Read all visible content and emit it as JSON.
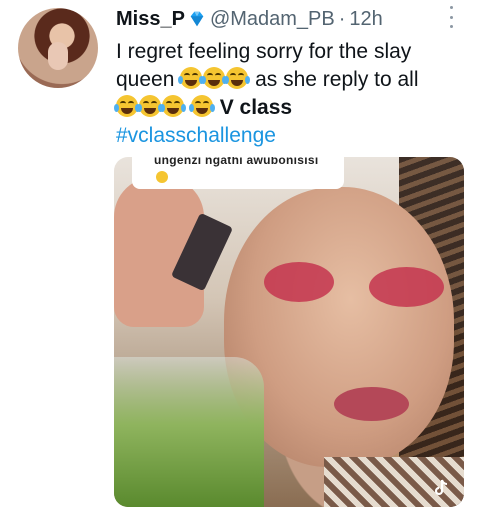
{
  "author": {
    "name": "Miss_P",
    "handle": "@Madam_PB",
    "separator": "·",
    "time": "12h",
    "badge_icon": "blue-diamond-icon"
  },
  "tweet": {
    "line1": "I regret feeling sorry for the slay",
    "line2_text": "queen",
    "line2_after": "as she reply to all",
    "line3_after": "V class",
    "hashtag": "#vclasschallenge",
    "emoji_icon": "face-with-tears-of-joy-icon"
  },
  "media": {
    "caption_text": "ungenzi ngathi awubonisisi",
    "caption_emoji_icon": "relieved-face-icon",
    "watermark_icon": "tiktok-icon"
  },
  "colors": {
    "hashtag": "#1b95e0",
    "secondary_text": "#536471",
    "badge": "#1da1f2"
  }
}
